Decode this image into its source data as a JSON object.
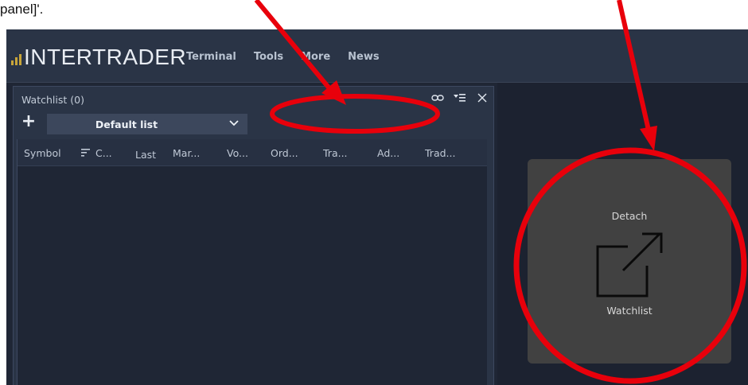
{
  "caption": "panel]'.",
  "app": {
    "logo_text": "INTERTRADER",
    "nav": [
      "Terminal",
      "Tools",
      "More",
      "News"
    ]
  },
  "watchlist": {
    "title": "Watchlist (0)",
    "add_label": "+",
    "list_name": "Default list",
    "columns": [
      "Symbol",
      "C...",
      "Last",
      "Mar...",
      "Vo...",
      "Ord...",
      "Tra...",
      "Ad...",
      "Trad..."
    ]
  },
  "detach_panel": {
    "label_top": "Detach",
    "label_bottom": "Watchlist"
  },
  "colors": {
    "app_bg": "#1f2635",
    "topbar_bg": "#2a3446",
    "logo_bars": "#c8a53a",
    "detach_bg": "#414141",
    "annotation": "#e8000b"
  }
}
